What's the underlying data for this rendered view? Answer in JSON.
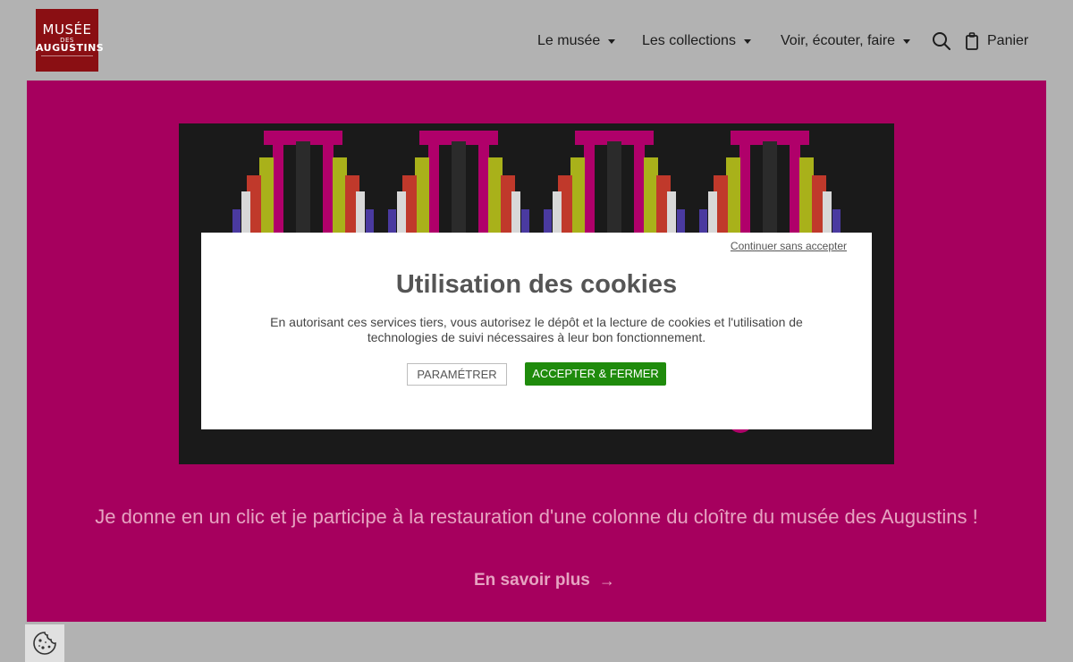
{
  "header": {
    "logo": {
      "line1": "MUSÉE",
      "line2": "DES",
      "line3": "AUGUSTINS"
    },
    "nav": [
      {
        "label": "Le musée"
      },
      {
        "label": "Les collections"
      },
      {
        "label": "Voir, écouter, faire"
      }
    ],
    "search_icon": "search-icon",
    "cart_label": "Panier"
  },
  "hero": {
    "text": "Je donne en un clic et je participe à la restauration d'une colonne du cloître du musée des Augustins !",
    "link_label": "En savoir plus",
    "background": "#a6005e"
  },
  "cookie_modal": {
    "skip_label": "Continuer sans accepter",
    "title": "Utilisation des cookies",
    "body": "En autorisant ces services tiers, vous autorisez le dépôt et la lecture de cookies et l'utilisation de technologies de suivi nécessaires à leur bon fonctionnement.",
    "param_label": "PARAMÉTRER",
    "accept_label": "ACCEPTER & FERMER",
    "accept_color": "#1f8b0c"
  },
  "cookie_button_icon": "cookie-icon"
}
